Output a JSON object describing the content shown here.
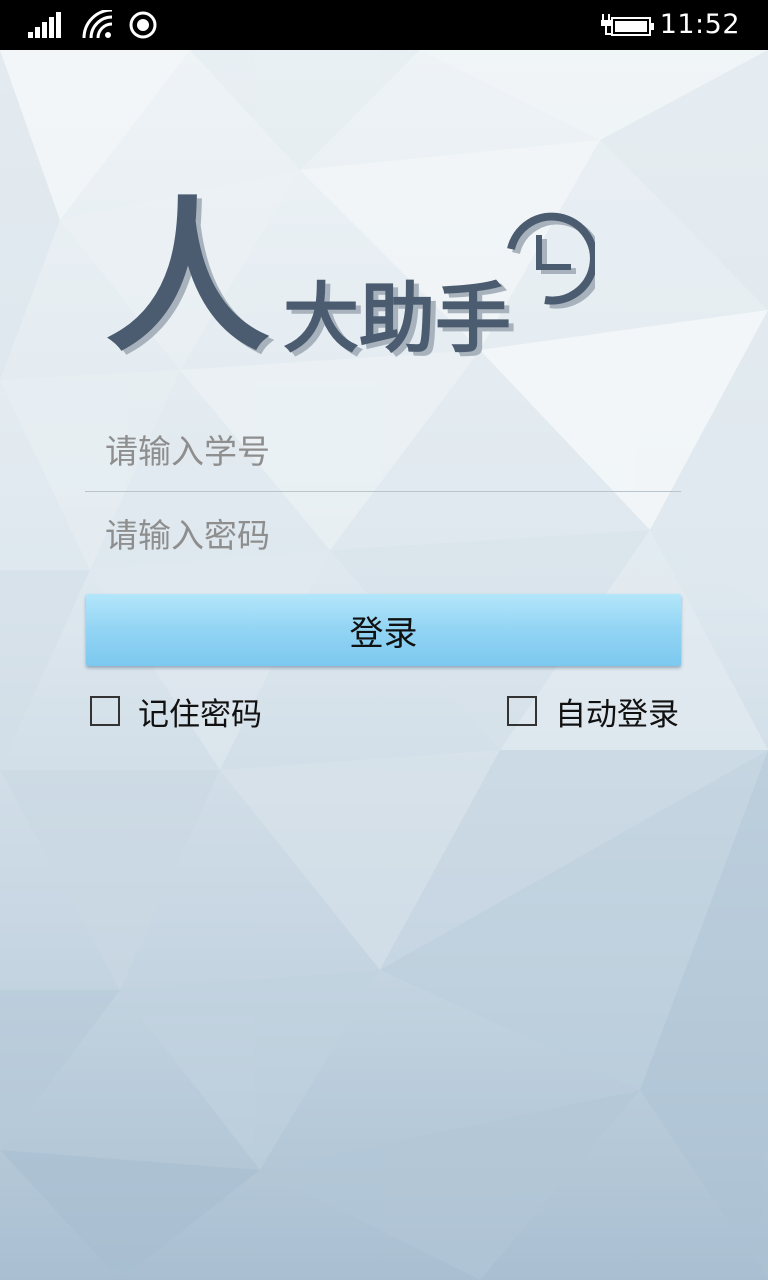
{
  "status_bar": {
    "time": "11:52",
    "icons": [
      "signal-icon",
      "wifi-icon",
      "location-icon",
      "battery-charging-icon"
    ]
  },
  "logo": {
    "big_char": "人",
    "rest": "大助手",
    "colors": {
      "main": "#4c5b70",
      "shadow": "#a8b2bc"
    }
  },
  "login_form": {
    "student_id_placeholder": "请输入学号",
    "password_placeholder": "请输入密码",
    "login_button_label": "登录",
    "remember_password_label": "记住密码",
    "auto_login_label": "自动登录"
  },
  "colors": {
    "button_top": "#b3e6fa",
    "button_bottom": "#7cc8ef",
    "background": "#c9d8e4"
  }
}
